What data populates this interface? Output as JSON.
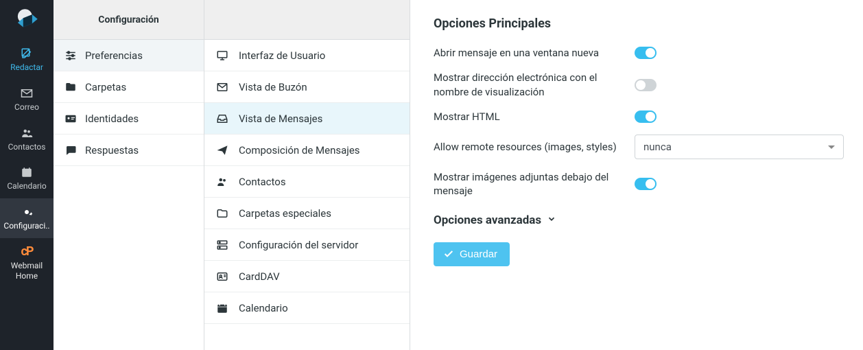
{
  "rail": {
    "items": [
      {
        "key": "compose",
        "label": "Redactar"
      },
      {
        "key": "mail",
        "label": "Correo"
      },
      {
        "key": "contacts",
        "label": "Contactos"
      },
      {
        "key": "calendar",
        "label": "Calendario"
      },
      {
        "key": "settings",
        "label": "Configuraci.."
      },
      {
        "key": "webmail",
        "label_line1": "Webmail",
        "label_line2": "Home"
      }
    ]
  },
  "settings": {
    "header": "Configuración",
    "categories": [
      {
        "label": "Preferencias"
      },
      {
        "label": "Carpetas"
      },
      {
        "label": "Identidades"
      },
      {
        "label": "Respuestas"
      }
    ]
  },
  "sections": {
    "items": [
      {
        "label": "Interfaz de Usuario"
      },
      {
        "label": "Vista de Buzón"
      },
      {
        "label": "Vista de Mensajes"
      },
      {
        "label": "Composición de Mensajes"
      },
      {
        "label": "Contactos"
      },
      {
        "label": "Carpetas especiales"
      },
      {
        "label": "Configuración del servidor"
      },
      {
        "label": "CardDAV"
      },
      {
        "label": "Calendario"
      }
    ]
  },
  "main": {
    "title": "Opciones Principales",
    "options": {
      "open_new_window": {
        "label": "Abrir mensaje en una ventana nueva",
        "value": true
      },
      "show_email_with_name": {
        "label": "Mostrar dirección electrónica con el nombre de visualización",
        "value": false
      },
      "show_html": {
        "label": "Mostrar HTML",
        "value": true
      },
      "allow_remote": {
        "label": "Allow remote resources (images, styles)",
        "selected": "nunca"
      },
      "inline_images": {
        "label": "Mostrar imágenes adjuntas debajo del mensaje",
        "value": true
      }
    },
    "advanced_title": "Opciones avanzadas",
    "save_label": "Guardar"
  },
  "colors": {
    "accent": "#37beef",
    "rail_bg": "#1e232a",
    "rail_active": "#3fb9eb"
  }
}
